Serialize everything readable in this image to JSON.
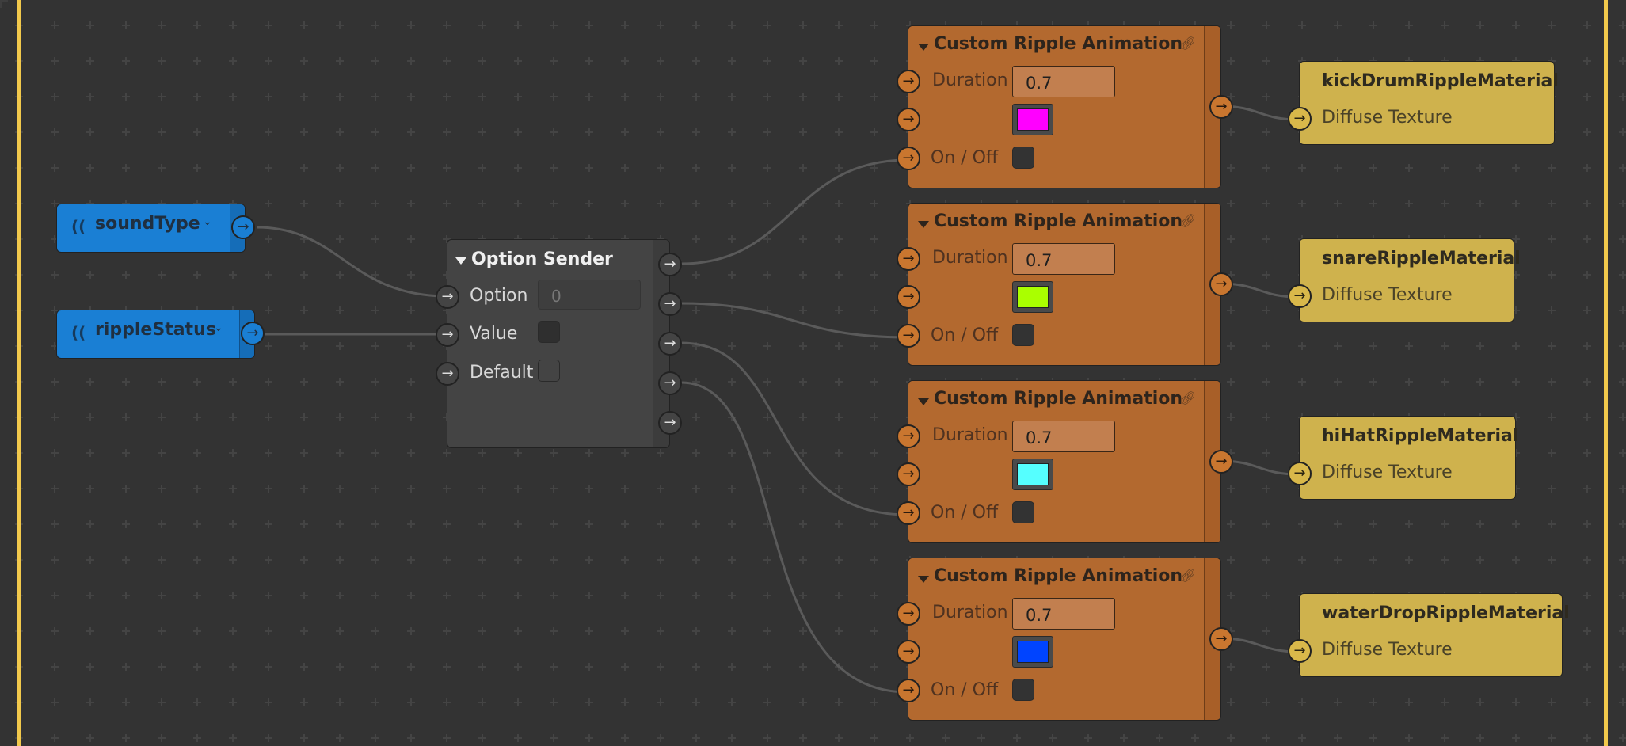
{
  "canvas": {
    "frame_color": "#f2c94c",
    "background": "#333333"
  },
  "variables": [
    {
      "name": "soundType",
      "icon": "signal-icon",
      "chevron": "⌄"
    },
    {
      "name": "rippleStatus",
      "icon": "signal-icon",
      "chevron": "⌄"
    }
  ],
  "option_sender": {
    "title": "Option Sender",
    "rows": [
      {
        "label": "Option",
        "value": "0"
      },
      {
        "label": "Value",
        "checked": false
      },
      {
        "label": "Default",
        "checked": false
      }
    ],
    "output_count": 5
  },
  "animations": [
    {
      "title": "Custom Ripple Animation",
      "duration_label": "Duration",
      "duration": "0.7",
      "color": "#ff00ff",
      "toggle_label": "On / Off",
      "on": false
    },
    {
      "title": "Custom Ripple Animation",
      "duration_label": "Duration",
      "duration": "0.7",
      "color": "#aaff00",
      "toggle_label": "On / Off",
      "on": false
    },
    {
      "title": "Custom Ripple Animation",
      "duration_label": "Duration",
      "duration": "0.7",
      "color": "#55ffff",
      "toggle_label": "On / Off",
      "on": false
    },
    {
      "title": "Custom Ripple Animation",
      "duration_label": "Duration",
      "duration": "0.7",
      "color": "#0044ff",
      "toggle_label": "On / Off",
      "on": false
    }
  ],
  "materials": [
    {
      "name": "kickDrumRippleMaterial",
      "input_label": "Diffuse Texture"
    },
    {
      "name": "snareRippleMaterial",
      "input_label": "Diffuse Texture"
    },
    {
      "name": "hiHatRippleMaterial",
      "input_label": "Diffuse Texture"
    },
    {
      "name": "waterDropRippleMaterial",
      "input_label": "Diffuse Texture"
    }
  ]
}
